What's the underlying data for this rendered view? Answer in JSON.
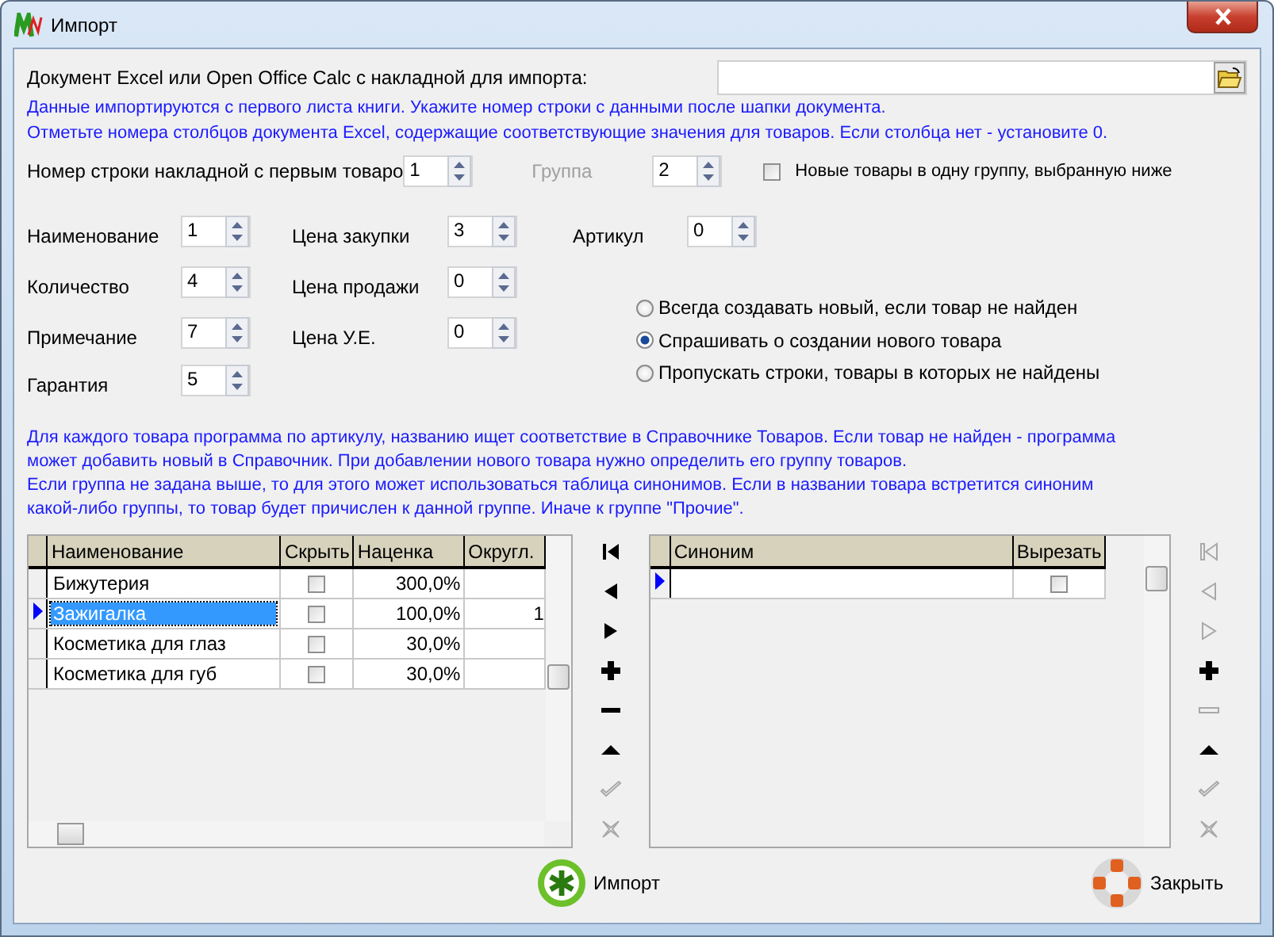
{
  "window": {
    "title": "Импорт"
  },
  "file": {
    "label": "Документ Excel или Open Office Calc с накладной для импорта:"
  },
  "info_lines": [
    "Данные импортируются с первого листа книги. Укажите номер строки с данными после шапки документа.",
    "Отметьте номера столбцов документа Excel, содержащие соответствующие значения для товаров. Если столбца нет - установите 0."
  ],
  "start_row": {
    "label": "Номер строки накладной с первым товаро",
    "value": "1"
  },
  "group": {
    "label": "Группа",
    "disabled": true,
    "value": "2"
  },
  "same_group": {
    "label": "Новые товары в одну группу, выбранную ниже",
    "checked": false
  },
  "field_columns": [
    [
      {
        "label": "Наименование",
        "value": "1"
      },
      {
        "label": "Количество",
        "value": "4"
      },
      {
        "label": "Примечание",
        "value": "7"
      },
      {
        "label": "Гарантия",
        "value": "5"
      }
    ],
    [
      {
        "label": "Цена закупки",
        "value": "3"
      },
      {
        "label": "Цена продажи",
        "value": "0"
      },
      {
        "label": "Цена У.Е.",
        "value": "0"
      }
    ],
    [
      {
        "label": "Артикул",
        "value": "0"
      }
    ]
  ],
  "modes": [
    {
      "label": "Всегда создавать новый, если товар не найден",
      "selected": false
    },
    {
      "label": "Спрашивать о создании нового товара",
      "selected": true
    },
    {
      "label": "Пропускать строки, товары в которых не найдены",
      "selected": false
    }
  ],
  "notes": [
    "Для каждого товара программа по артикулу, названию ищет соответствие в Справочнике Товаров. Если товар не найден - программа может добавить новый в Справочник. При добавлении нового товара нужно определить его группу товаров.",
    "Если группа не задана выше, то для этого может использоваться таблица синонимов. Если в названии товара встретится синоним какой-либо группы, то товар будет причислен к данной группе. Иначе к группе \"Прочие\"."
  ],
  "groups_table": {
    "columns": [
      "Наименование",
      "Скрыть",
      "Наценка",
      "Округл."
    ],
    "rows": [
      {
        "name": "Бижутерия",
        "hidden": false,
        "markup": "300,0%",
        "selected": false
      },
      {
        "name": "Зажигалка",
        "hidden": false,
        "markup": "100,0%",
        "round": "1",
        "selected": true
      },
      {
        "name": "Косметика для глаз",
        "hidden": false,
        "markup": "30,0%",
        "selected": false
      },
      {
        "name": "Косметика для губ",
        "hidden": false,
        "markup": "30,0%",
        "selected": false
      }
    ]
  },
  "synonyms_table": {
    "columns": [
      "Синоним",
      "Вырезать"
    ],
    "rows": [
      {
        "cut": false,
        "selected": true
      }
    ]
  },
  "navigators": [
    [
      {
        "kind": "first",
        "disabled": false
      },
      {
        "kind": "prior",
        "disabled": false
      },
      {
        "kind": "next",
        "disabled": false
      },
      {
        "kind": "insert",
        "disabled": false
      },
      {
        "kind": "delete",
        "disabled": false
      },
      {
        "kind": "up",
        "disabled": false
      },
      {
        "kind": "post",
        "disabled": true
      },
      {
        "kind": "cancel",
        "disabled": true
      }
    ],
    [
      {
        "kind": "first",
        "disabled": true
      },
      {
        "kind": "prior",
        "disabled": true
      },
      {
        "kind": "next",
        "disabled": true
      },
      {
        "kind": "insert",
        "disabled": false
      },
      {
        "kind": "delete",
        "disabled": true
      },
      {
        "kind": "up",
        "disabled": false
      },
      {
        "kind": "post",
        "disabled": true
      },
      {
        "kind": "cancel",
        "disabled": true
      }
    ]
  ],
  "buttons": [
    {
      "label": "Импорт",
      "kind": "import"
    },
    {
      "label": "Закрыть",
      "kind": "close"
    }
  ]
}
